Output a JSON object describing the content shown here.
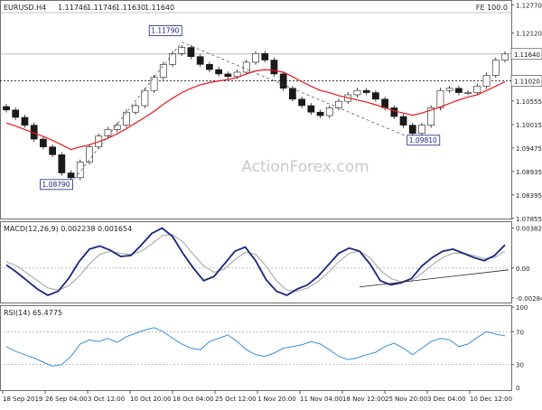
{
  "chart_data": [
    {
      "panel": "price",
      "type": "candlestick",
      "title": "EURUSD.H4",
      "ohlc_header": [
        "1.11746",
        "1.11746",
        "1.11630",
        "1.11640"
      ],
      "top_right_label": "FE 100.0",
      "watermark": "ActionForex.com",
      "yticks": [
        "1.12770",
        "1.12120",
        "1.11640",
        "1.11020",
        "1.10555",
        "1.10015",
        "1.09475",
        "1.08935",
        "1.08395",
        "1.07855"
      ],
      "ylim": [
        1.0785,
        1.128
      ],
      "current_price": "1.11640",
      "horizontal_line": "1.11020",
      "annotations": [
        {
          "label": "1.11790",
          "value": 1.1179
        },
        {
          "label": "1.08790",
          "value": 1.0879
        },
        {
          "label": "1.09810",
          "value": 1.0981
        },
        {
          "label": "1.11020",
          "value": 1.1102
        }
      ],
      "series": [
        {
          "role": "close",
          "color": "#1a1a1a",
          "values": [
            1.1035,
            1.1018,
            1.1,
            1.0968,
            1.095,
            1.0932,
            1.089,
            1.0879,
            1.0915,
            1.095,
            1.0975,
            1.099,
            1.1,
            1.103,
            1.1045,
            1.108,
            1.111,
            1.114,
            1.1165,
            1.1179,
            1.1158,
            1.114,
            1.1128,
            1.1118,
            1.1112,
            1.1122,
            1.1145,
            1.1165,
            1.115,
            1.1118,
            1.1085,
            1.106,
            1.1045,
            1.103,
            1.1022,
            1.104,
            1.1055,
            1.107,
            1.108,
            1.1075,
            1.106,
            1.104,
            1.102,
            1.1,
            1.0981,
            1.1,
            1.104,
            1.108,
            1.1085,
            1.1075,
            1.1075,
            1.109,
            1.1115,
            1.115,
            1.1164
          ]
        },
        {
          "role": "moving-average",
          "color": "#e8161b",
          "values": [
            1.1005,
            1.0998,
            1.099,
            1.0982,
            1.0974,
            1.0965,
            1.0955,
            1.0944,
            1.095,
            1.0955,
            1.0962,
            1.097,
            1.098,
            1.0992,
            1.1005,
            1.1018,
            1.1032,
            1.1048,
            1.1062,
            1.1075,
            1.1085,
            1.1093,
            1.1098,
            1.1102,
            1.1105,
            1.111,
            1.1118,
            1.1125,
            1.1128,
            1.1126,
            1.1122,
            1.1112,
            1.11,
            1.109,
            1.108,
            1.1075,
            1.1068,
            1.1063,
            1.1058,
            1.1053,
            1.1047,
            1.104,
            1.1033,
            1.1028,
            1.1023,
            1.1028,
            1.1035,
            1.1042,
            1.105,
            1.1058,
            1.1065,
            1.107,
            1.108,
            1.109,
            1.11
          ]
        }
      ]
    },
    {
      "panel": "macd",
      "type": "line",
      "label": "MACD(12,26,9) 0.002238 0.001654",
      "yticks": [
        "0.003826",
        "0.00",
        "-0.002849"
      ],
      "ylim": [
        -0.0032,
        0.0042
      ],
      "series": [
        {
          "role": "macd",
          "color": "#1a237e",
          "values": [
            0.0003,
            -0.0004,
            -0.0012,
            -0.002,
            -0.0026,
            -0.0022,
            -0.001,
            0.0006,
            0.0018,
            0.0021,
            0.0017,
            0.0011,
            0.0012,
            0.0022,
            0.0033,
            0.0038,
            0.003,
            0.0014,
            0.0,
            -0.0012,
            -0.0008,
            0.0004,
            0.0016,
            0.002,
            0.0007,
            -0.0011,
            -0.0022,
            -0.0026,
            -0.002,
            -0.0016,
            -0.0008,
            0.0003,
            0.0014,
            0.0019,
            0.0016,
            0.0004,
            -0.0012,
            -0.0016,
            -0.0014,
            -0.001,
            0.0002,
            0.001,
            0.0016,
            0.0018,
            0.0014,
            0.001,
            0.0007,
            0.0012,
            0.0022
          ]
        },
        {
          "role": "signal",
          "color": "#b0b0b0",
          "values": [
            0.0006,
            0.0002,
            -0.0005,
            -0.0012,
            -0.0019,
            -0.0021,
            -0.0017,
            -0.0008,
            0.0004,
            0.0013,
            0.0016,
            0.0014,
            0.0013,
            0.0016,
            0.0023,
            0.0031,
            0.0032,
            0.0025,
            0.0013,
            0.0002,
            -0.0004,
            -0.0001,
            0.0008,
            0.0015,
            0.0013,
            0.0002,
            -0.0012,
            -0.0021,
            -0.0022,
            -0.0019,
            -0.0013,
            -0.0004,
            0.0006,
            0.0014,
            0.0016,
            0.001,
            -0.0002,
            -0.001,
            -0.0013,
            -0.0012,
            -0.0005,
            0.0003,
            0.001,
            0.0014,
            0.0014,
            0.0012,
            0.0009,
            0.001,
            0.0016
          ]
        }
      ]
    },
    {
      "panel": "rsi",
      "type": "line",
      "label": "RSI(14) 65.4775",
      "yticks": [
        "100",
        "70",
        "30",
        "0"
      ],
      "ylim": [
        0,
        100
      ],
      "reference_lines": [
        70,
        30
      ],
      "series": [
        {
          "role": "rsi",
          "color": "#3b8fd9",
          "values": [
            52,
            46,
            42,
            38,
            33,
            28,
            30,
            40,
            55,
            60,
            58,
            62,
            57,
            64,
            68,
            72,
            75,
            70,
            62,
            55,
            50,
            48,
            58,
            62,
            66,
            58,
            48,
            42,
            40,
            44,
            50,
            52,
            54,
            58,
            55,
            48,
            40,
            36,
            38,
            42,
            45,
            52,
            56,
            50,
            42,
            50,
            58,
            62,
            60,
            52,
            55,
            63,
            70,
            67,
            65
          ]
        }
      ]
    }
  ],
  "x_axis": {
    "ticks": [
      "18 Sep 2019",
      "26 Sep 04:00",
      "3 Oct 12:00",
      "10 Oct 20:00",
      "18 Oct 04:00",
      "25 Oct 12:00",
      "1 Nov 20:00",
      "11 Nov 04:00",
      "18 Nov 12:00",
      "25 Nov 20:00",
      "3 Dec 04:00",
      "10 Dec 12:00"
    ]
  },
  "colors": {
    "bullish_candle": "#ffffff",
    "bearish_candle": "#1a1a1a",
    "ma": "#e8161b",
    "macd": "#1a237e",
    "signal": "#b0b0b0",
    "rsi": "#3b8fd9",
    "grid": "#d8d8d8",
    "watermark": "#c8c8c8"
  }
}
